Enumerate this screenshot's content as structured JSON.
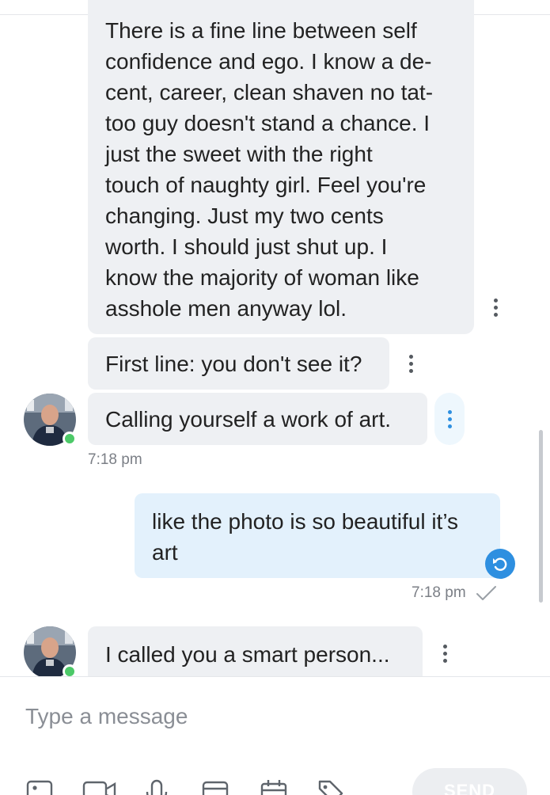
{
  "messages": [
    {
      "direction": "incoming",
      "lines": [
        "There is a fine line between self",
        "confidence and ego. I know a de-",
        "cent, career, clean shaven no tat-",
        "too guy doesn't stand a chance. I",
        "just the sweet with the right",
        "touch of naughty girl. Feel you're",
        "changing. Just my two cents",
        "worth. I should just shut up. I",
        "know the majority of woman like",
        "asshole men anyway lol."
      ]
    },
    {
      "direction": "incoming",
      "text": "First line: you don't see it?"
    },
    {
      "direction": "incoming",
      "text": "Calling yourself a work of art.",
      "time": "7:18 pm"
    },
    {
      "direction": "outgoing",
      "lines": [
        "like the photo is so beautiful it’s",
        "art"
      ],
      "time": "7:18 pm",
      "status_icon": "checkmark-icon",
      "retry_icon": "undo-icon"
    },
    {
      "direction": "incoming",
      "text": "I called you a smart person..."
    }
  ],
  "composer": {
    "placeholder": "Type a message",
    "send_label": "SEND",
    "tools": [
      "image-icon",
      "video-icon",
      "microphone-icon",
      "gift-card-icon",
      "calendar-icon",
      "tag-icon"
    ]
  },
  "colors": {
    "incoming_bubble": "#eef0f3",
    "outgoing_bubble": "#e3f1fc",
    "presence": "#4cc968",
    "accent": "#2e8fe0"
  }
}
